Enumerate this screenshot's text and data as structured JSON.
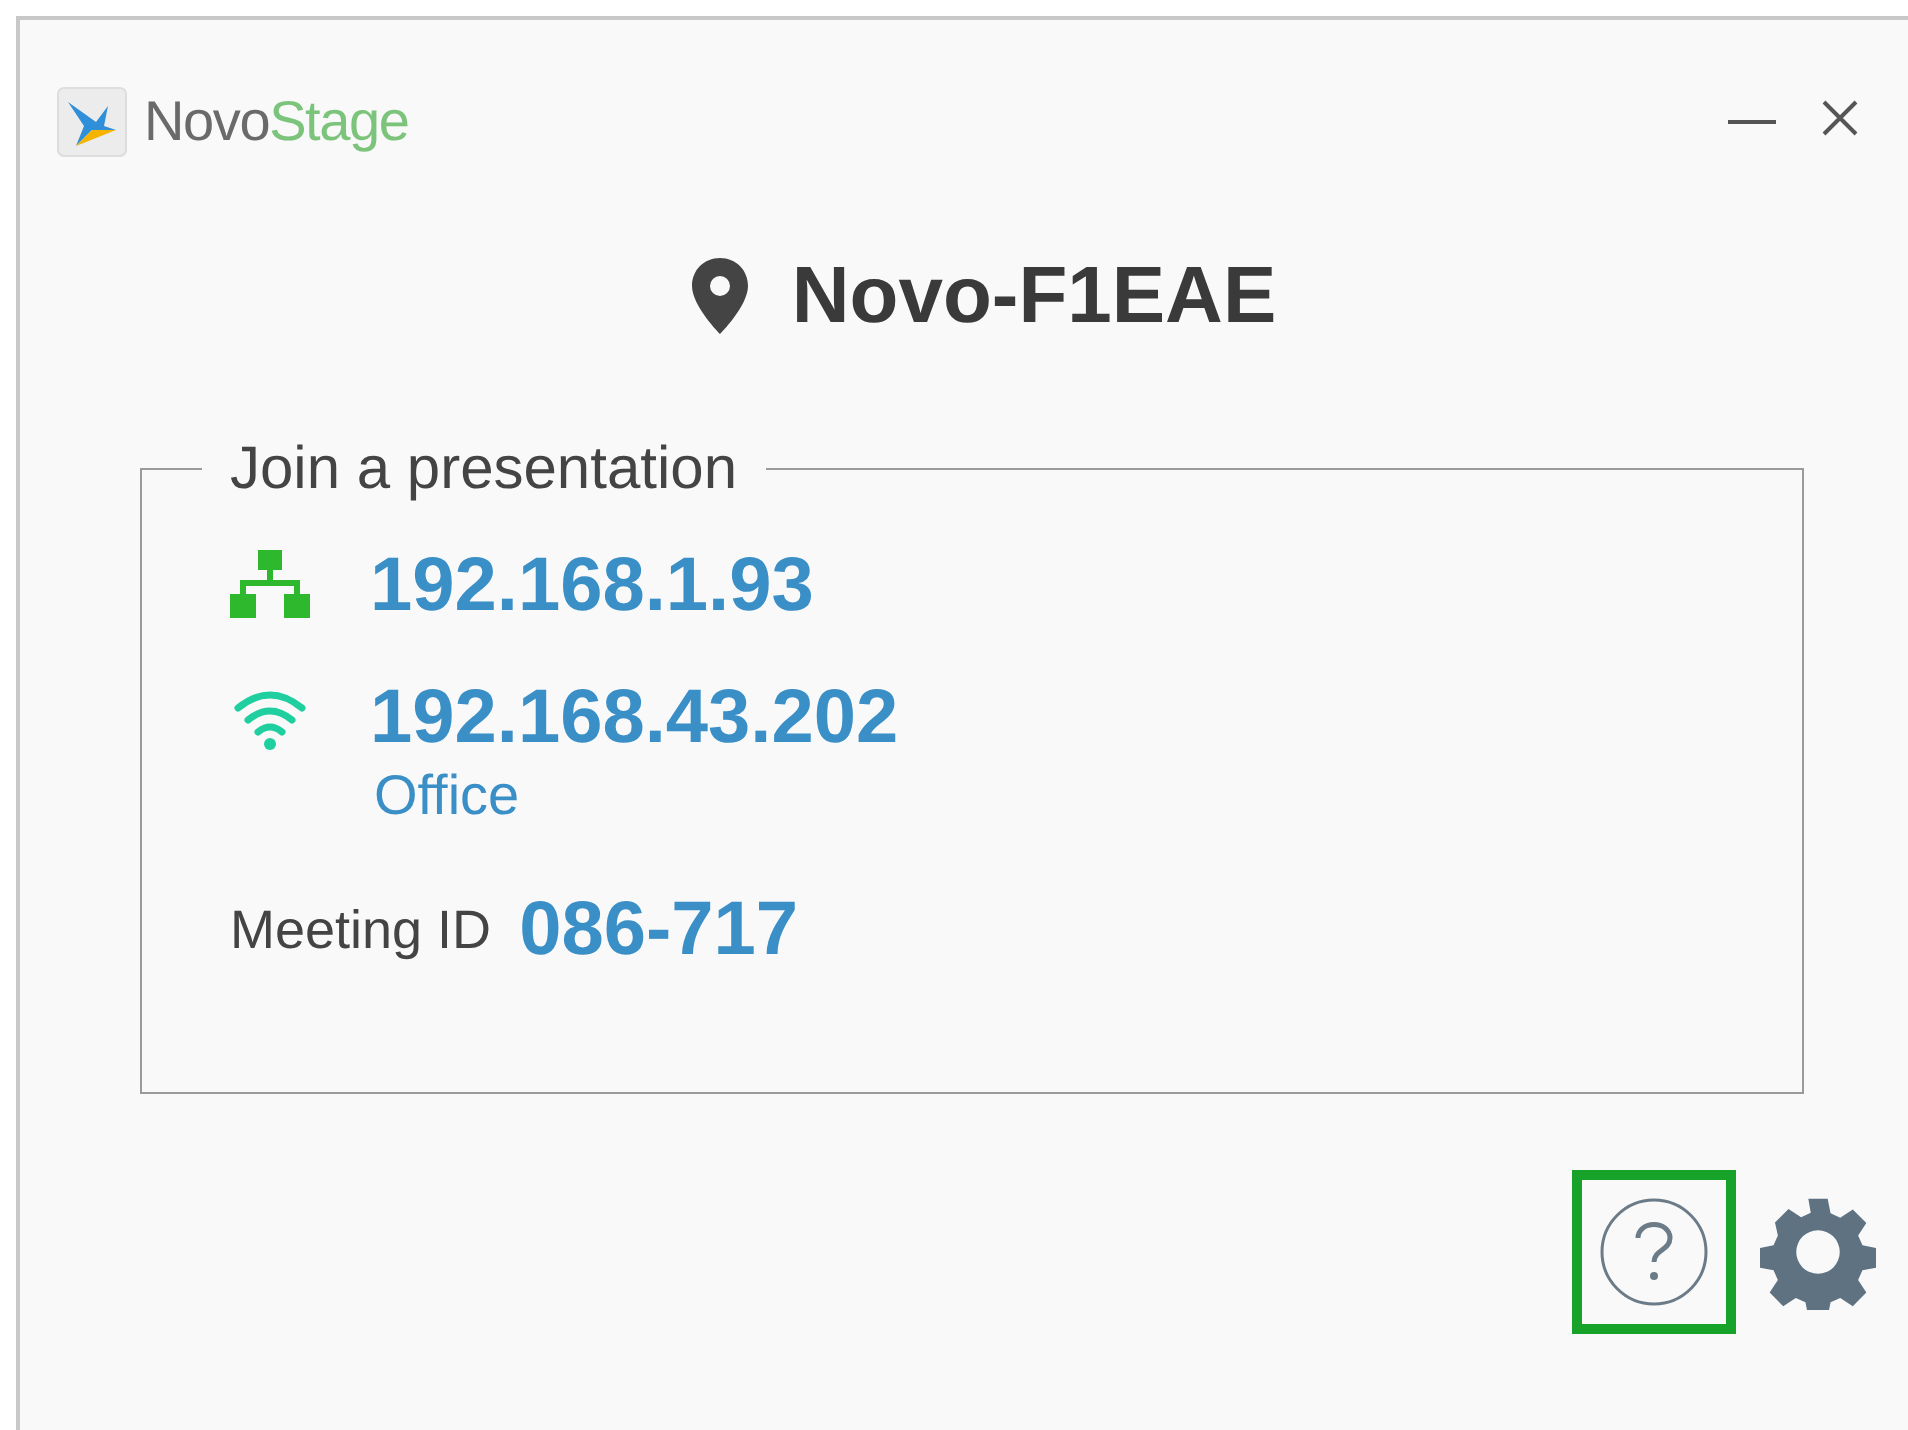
{
  "app": {
    "name_part_1": "Novo",
    "name_part_2": "Stage"
  },
  "device_name": "Novo-F1EAE",
  "join_panel": {
    "title": "Join a presentation",
    "connections": [
      {
        "kind": "wired",
        "address": "192.168.1.93"
      },
      {
        "kind": "wifi",
        "address": "192.168.43.202",
        "network": "Office"
      }
    ],
    "meeting_id_label": "Meeting ID",
    "meeting_id": "086-717"
  },
  "help_button": {
    "highlighted": true
  }
}
